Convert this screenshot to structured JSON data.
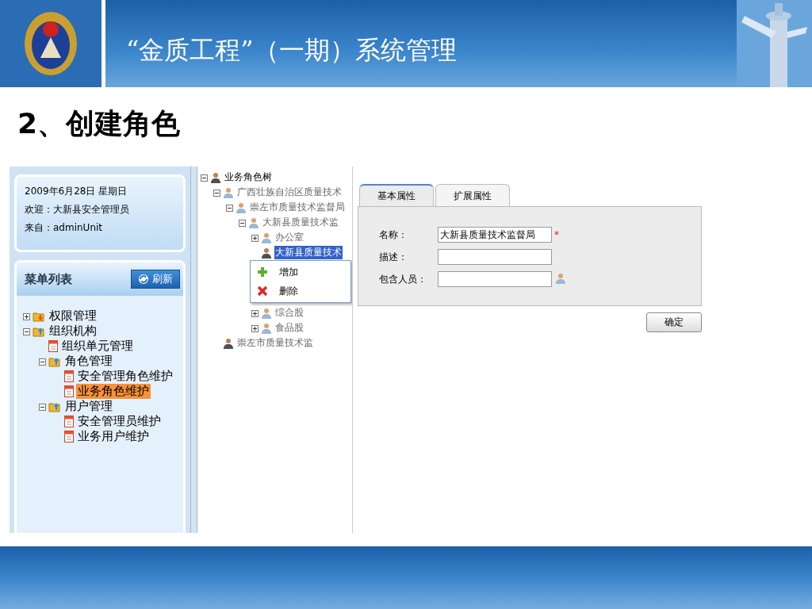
{
  "slide": {
    "title": "“金质工程”（一期）系统管理",
    "heading": "2、创建角色"
  },
  "info": {
    "lines": [
      "2009年6月28日 星期日",
      "欢迎：大新县安全管理员",
      "来自：adminUnit"
    ]
  },
  "menu": {
    "title": "菜单列表",
    "refresh": "刷新",
    "tree": [
      {
        "label": "权限管理",
        "kind": "folder_down",
        "expanded": false,
        "selected": false
      },
      {
        "label": "组织机构",
        "kind": "folder_up",
        "expanded": true,
        "selected": false,
        "children": [
          {
            "label": "组织单元管理",
            "kind": "page",
            "selected": false
          },
          {
            "label": "角色管理",
            "kind": "folder_up",
            "expanded": true,
            "selected": false,
            "children": [
              {
                "label": "安全管理角色维护",
                "kind": "page",
                "selected": false
              },
              {
                "label": "业务角色维护",
                "kind": "page",
                "selected": true
              }
            ]
          },
          {
            "label": "用户管理",
            "kind": "folder_up",
            "expanded": true,
            "selected": false,
            "children": [
              {
                "label": "安全管理员维护",
                "kind": "page",
                "selected": false
              },
              {
                "label": "业务用户维护",
                "kind": "page",
                "selected": false
              }
            ]
          }
        ]
      }
    ]
  },
  "role_tree": [
    {
      "label": "业务角色树",
      "kind": "root",
      "expanded": true,
      "selected": false,
      "children": [
        {
          "label": "广西壮族自治区质量技术",
          "kind": "group",
          "expanded": true,
          "selected": false,
          "children": [
            {
              "label": "崇左市质量技术监督局",
              "kind": "group",
              "expanded": true,
              "selected": false,
              "children": [
                {
                  "label": "大新县质量技术监",
                  "kind": "group",
                  "expanded": true,
                  "selected": false,
                  "children": [
                    {
                      "label": "办公室",
                      "kind": "group",
                      "expanded": false,
                      "selected": false
                    },
                    {
                      "label": "大新县质量技术",
                      "kind": "role",
                      "selected": true
                    },
                    {
                      "label": "综合股",
                      "kind": "group",
                      "expanded": false,
                      "selected": false
                    },
                    {
                      "label": "食品股",
                      "kind": "group",
                      "expanded": false,
                      "selected": false
                    }
                  ]
                }
              ]
            }
          ]
        },
        {
          "label": "崇左市质量技术监",
          "kind": "role",
          "selected": false
        }
      ]
    }
  ],
  "context_menu": [
    {
      "label": "增加",
      "kind": "add"
    },
    {
      "label": "删除",
      "kind": "delete"
    }
  ],
  "form": {
    "tabs": [
      {
        "label": "基本属性",
        "selected": true
      },
      {
        "label": "扩展属性",
        "selected": false
      }
    ],
    "fields": [
      {
        "label": "名称：",
        "value": "大新县质量技术监督局",
        "required_mark": "*",
        "kind": "text"
      },
      {
        "label": "描述：",
        "kind": "text"
      },
      {
        "label": "包含人员：",
        "kind": "person_picker"
      }
    ],
    "confirm": "确定"
  }
}
